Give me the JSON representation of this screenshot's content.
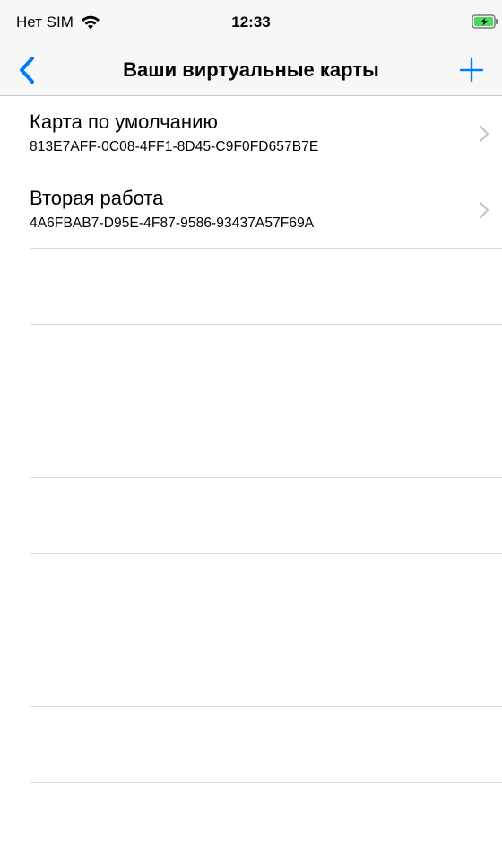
{
  "status_bar": {
    "carrier": "Нет SIM",
    "time": "12:33",
    "icons": [
      "wifi-icon",
      "battery-charging-icon"
    ]
  },
  "nav_bar": {
    "title": "Ваши виртуальные карты",
    "back_icon": "chevron-left-icon",
    "add_icon": "plus-icon",
    "accent_color": "#007aff"
  },
  "cards": [
    {
      "title": "Карта по умолчанию",
      "id": "813E7AFF-0C08-4FF1-8D45-C9F0FD657B7E"
    },
    {
      "title": "Вторая работа",
      "id": "4A6FBAB7-D95E-4F87-9586-93437A57F69A"
    }
  ]
}
